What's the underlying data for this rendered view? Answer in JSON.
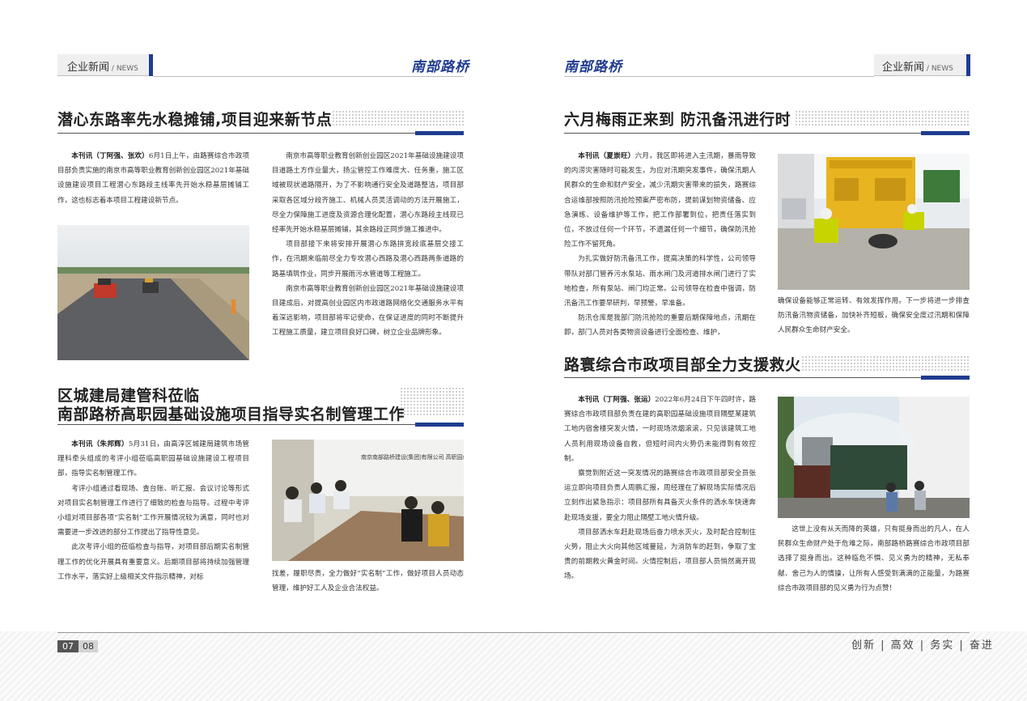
{
  "left_header": {
    "tab_cn": "企业新闻",
    "slash": "/",
    "tab_en": "NEWS",
    "brand": "南部路桥"
  },
  "right_header": {
    "tab_cn": "企业新闻",
    "slash": "/",
    "tab_en": "NEWS",
    "brand": "南部路桥"
  },
  "article1": {
    "title": "潜心东路率先水稳摊铺,项目迎来新节点",
    "byline": "本刊讯（丁阿强、张欢）",
    "p1": "6月1日上午，由路赛综合市政项目部负责实施的南京市高等职业教育创新创业园区2021年基础设施建设项目工程潜心东路段主线率先开始水稳基层摊铺工作，这也标志着本项目工程建设新节点。",
    "p2": "南京市高等职业教育创新创业园区2021年基础设施建设项目道路土方作业量大，扬尘管控工作难度大、任务重，施工区域被现状道路隔开，为了不影响通行安全及道路整洁，项目部采取各区域分段齐施工、机械人员灵活调动的方法开展施工，尽全力保障施工进度及资源合理化配置，潜心东路段主线现已经率先开始水稳基层摊铺，其余路段正同步施工推进中。",
    "p3": "项目部接下来将安排开展潜心东路拼宽段底基层交接工作，在汛期来临前尽全力专攻潜心西路及潜心西路两条道路的路基填筑作业，同步开展雨污水管道等工程施工。",
    "p4": "南京市高等职业教育创新创业园区2021年基础设施建设项目建成后，对提高创业园区内市政道路网络化交通服务水平有着深远影响，项目部将牢记使命，在保证进度的同时不断提升工程施工质量，建立项目良好口碑，树立企业品牌形象。"
  },
  "article2": {
    "title_line1": "区城建局建管科莅临",
    "title_line2": "南部路桥高职园基础设施项目指导实名制管理工作",
    "byline": "本刊讯（朱邦辉）",
    "p1": "5月31日，由高淳区城建局建筑市场管理科牵头组成的考评小组莅临高职园基础设施建设工程项目部，指导实名制管理工作。",
    "p2": "考评小组通过看现场、查台账、听汇报、会议讨论等形式对项目实名制管理工作进行了细致的检查与指导。过程中考评小组对项目部各项“实名制”工作开展情况较为满意，同时也对需要进一步改进的部分工作提出了指导性意见。",
    "p3": "此次考评小组的莅临检查与指导，对项目部后期实名制管理工作的优化开展具有重要意义。后期项目部将持续加强管理工作水平，落实好上级相关文件指示精神，对标",
    "p3_cont": "找差，履职尽责，全力做好“实名制”工作，做好项目人员动态管理，维护好工人及企业合法权益。",
    "photo_banner": "南京南部路桥建设(集团)有限公司 高职园创新创业园区基础设施建设项目"
  },
  "article3": {
    "title": "六月梅雨正来到 防汛备汛进行时",
    "byline": "本刊讯（夏崇旺）",
    "p1": "六月，我区即将进入主汛期，暴雨导致的内涝灾害随时可能发生，为应对汛期突发事件，确保汛期人民群众的生命和财产安全，减少汛期灾害带来的损失，路赛综合运维部按照防汛抢险预案严密布防，提前谋划物资储备、应急演练、设备维护等工作，把工作部署到位，把责任落实到位，不放过任何一个环节，不遗漏任何一个细节，确保防汛抢险工作不留死角。",
    "p2": "为扎实做好防汛备汛工作，提高决策的科学性，公司领导带队对部门管养污水泵站、雨水闸门及河道排水闸门进行了实地检查，所有泵站、闸门均正常。公司领导在检查中强调，防汛备汛工作要早研判，早预警，早准备。",
    "p3": "防汛仓库是我部门防汛抢险的重要后期保障地点，汛期在即，部门人员对各类物资设备进行全面检查、维护，",
    "p3_cont": "确保设备能够正常运转、有效发挥作用。下一步将进一步排查防汛备汛物资储备，加快补齐短板，确保安全度过汛期和保障人民群众生命财产安全。"
  },
  "article4": {
    "title": "路寰综合市政项目部全力支援救火",
    "byline": "本刊讯（丁阿强、张运）",
    "p1": "2022年6月24日下午四时许，路赛综合市政项目部负责在建的高职园基础设施项目隔壁某建筑工地内宿舍楼突发火情，一时现场浓烟滚滚，只见该建筑工地人员利用现场设备自救，但短时间内火势仍未能得到有效控制。",
    "p2": "察觉到附近这一突发情况的路赛综合市政项目部安全员张运立即向项目负责人周鹏汇报，周经理在了解现场实际情况后立刻作出紧急指示：项目部所有具备灭火条件的洒水车快速奔赴现场支援，要全力阻止隔壁工地火情升级。",
    "p3": "项目部洒水车赶赴现场后奋力喷水灭火，及时配合控制住火势，阻止大火向其他区域蔓延，为消防车的赶到，争取了宝贵的前期救火黄金时间。火情控制后，项目部人员悄然离开现场。",
    "p4": "这世上没有从天而降的英雄，只有挺身而出的凡人，在人民群众生命财产处于危难之际，南部路桥路赛综合市政项目部选择了挺身而出。这种临危不惧、见义勇为的精神，无私奉献、舍己为人的情操，让所有人感受到满满的正能量，为路赛综合市政项目部的见义勇为行为点赞！"
  },
  "footer": {
    "page_left": "07",
    "page_right": "08",
    "slogan": "创新 | 高效 | 务实 | 奋进"
  },
  "colors": {
    "accent": "#1f3c8f",
    "rule": "#555555"
  }
}
